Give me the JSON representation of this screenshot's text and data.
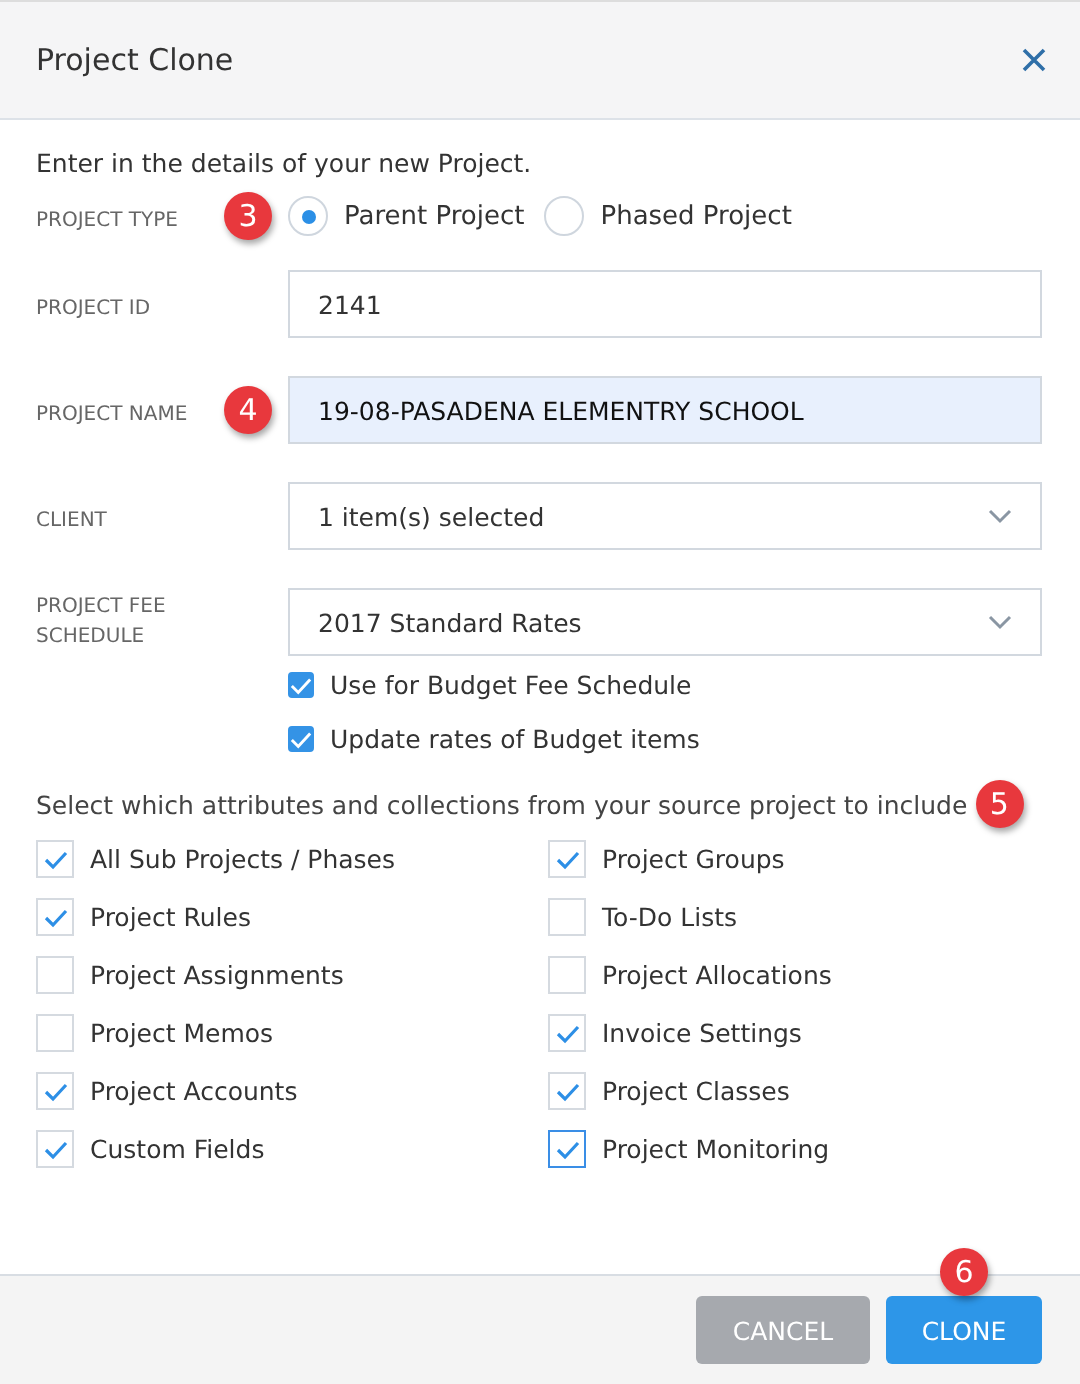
{
  "window": {
    "title": "Project Clone"
  },
  "intro": "Enter in the details of your new Project.",
  "fields": [
    {
      "kind": "radio",
      "label": "PROJECT TYPE",
      "callout": "3",
      "options": [
        {
          "label": "Parent Project",
          "selected": true
        },
        {
          "label": "Phased Project",
          "selected": false
        }
      ]
    },
    {
      "kind": "text",
      "label": "PROJECT ID",
      "value": "2141",
      "highlighted": false
    },
    {
      "kind": "text",
      "label": "PROJECT NAME",
      "callout": "4",
      "value": "19-08-PASADENA ELEMENTRY SCHOOL",
      "highlighted": true
    },
    {
      "kind": "select",
      "label": "CLIENT",
      "value": "1 item(s) selected"
    },
    {
      "kind": "select",
      "label": "PROJECT FEE SCHEDULE",
      "value": "2017 Standard Rates"
    }
  ],
  "fee_options": [
    {
      "label": "Use for Budget Fee Schedule",
      "checked": true
    },
    {
      "label": "Update rates of Budget items",
      "checked": true
    }
  ],
  "attributes_prompt": {
    "text": "Select which attributes and collections from your source project to include",
    "callout": "5"
  },
  "attributes": [
    {
      "label": "All Sub Projects / Phases",
      "checked": true
    },
    {
      "label": "Project Groups",
      "checked": true
    },
    {
      "label": "Project Rules",
      "checked": true
    },
    {
      "label": "To-Do Lists",
      "checked": false
    },
    {
      "label": "Project Assignments",
      "checked": false
    },
    {
      "label": "Project Allocations",
      "checked": false
    },
    {
      "label": "Project Memos",
      "checked": false
    },
    {
      "label": "Invoice Settings",
      "checked": true
    },
    {
      "label": "Project Accounts",
      "checked": true
    },
    {
      "label": "Project Classes",
      "checked": true
    },
    {
      "label": "Custom Fields",
      "checked": true
    },
    {
      "label": "Project Monitoring",
      "checked": true,
      "focused": true
    }
  ],
  "buttons": [
    {
      "kind": "secondary",
      "label": "CANCEL"
    },
    {
      "kind": "primary",
      "label": "CLONE",
      "callout": "6"
    }
  ]
}
